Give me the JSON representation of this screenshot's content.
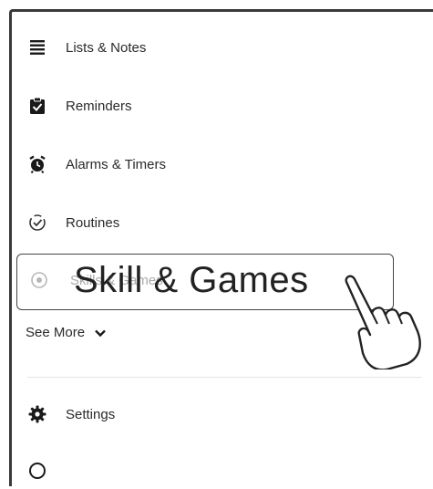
{
  "menu": {
    "items": [
      {
        "label": "Lists & Notes",
        "icon": "list-icon"
      },
      {
        "label": "Reminders",
        "icon": "clipboard-check-icon"
      },
      {
        "label": "Alarms & Timers",
        "icon": "alarm-clock-icon"
      },
      {
        "label": "Routines",
        "icon": "routine-check-icon"
      }
    ],
    "highlighted_item": {
      "label": "Skills & Games",
      "icon": "skills-icon"
    },
    "see_more": {
      "label": "See More",
      "icon": "chevron-down-icon"
    },
    "settings": {
      "label": "Settings",
      "icon": "gear-icon"
    }
  },
  "callout": {
    "text": "Skill & Games",
    "pointer_icon": "pointing-hand-icon"
  },
  "colors": {
    "text": "#2a2a2a",
    "border": "#3a3a3a",
    "divider": "#e4e4e4"
  }
}
